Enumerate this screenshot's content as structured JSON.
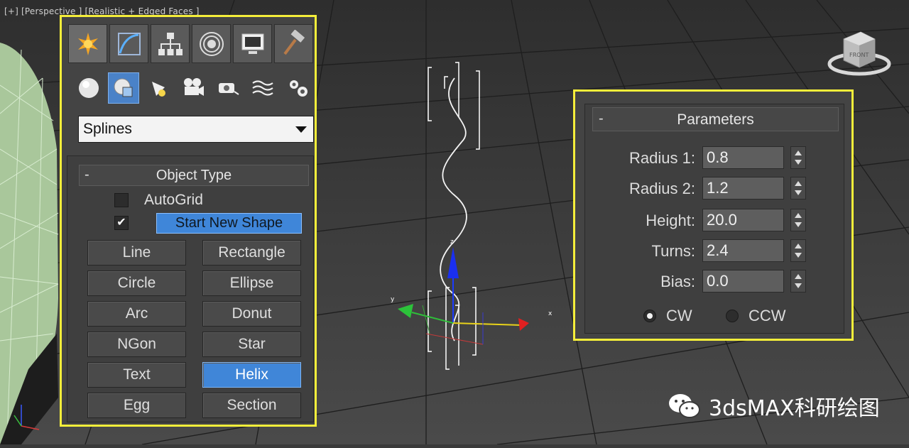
{
  "viewport": {
    "label": "[+] [Perspective ] [Realistic + Edged Faces ]",
    "axis_x": "x",
    "axis_y": "y",
    "axis_z": "z",
    "viewcube_label": "FRONT"
  },
  "command_panel": {
    "tabs": [
      {
        "icon": "create-icon",
        "active": true
      },
      {
        "icon": "modify-icon",
        "active": false
      },
      {
        "icon": "hierarchy-icon",
        "active": false
      },
      {
        "icon": "motion-icon",
        "active": false
      },
      {
        "icon": "display-icon",
        "active": false
      },
      {
        "icon": "utilities-icon",
        "active": false
      }
    ],
    "subtabs": [
      {
        "icon": "geometry-icon",
        "active": false
      },
      {
        "icon": "shapes-icon",
        "active": true
      },
      {
        "icon": "lights-icon",
        "active": false
      },
      {
        "icon": "cameras-icon",
        "active": false
      },
      {
        "icon": "helpers-icon",
        "active": false
      },
      {
        "icon": "spacewarps-icon",
        "active": false
      },
      {
        "icon": "systems-icon",
        "active": false
      }
    ],
    "category_dropdown": "Splines",
    "object_type": {
      "title": "Object Type",
      "collapse": "-",
      "autogrid_label": "AutoGrid",
      "autogrid_checked": false,
      "start_new_shape_checked": true,
      "start_new_shape_label": "Start New Shape",
      "buttons": [
        "Line",
        "Rectangle",
        "Circle",
        "Ellipse",
        "Arc",
        "Donut",
        "NGon",
        "Star",
        "Text",
        "Helix",
        "Egg",
        "Section"
      ],
      "active_button": "Helix"
    }
  },
  "parameters": {
    "title": "Parameters",
    "collapse": "-",
    "radius1_label": "Radius 1:",
    "radius1_value": "0.8",
    "radius2_label": "Radius 2:",
    "radius2_value": "1.2",
    "height_label": "Height:",
    "height_value": "20.0",
    "turns_label": "Turns:",
    "turns_value": "2.4",
    "bias_label": "Bias:",
    "bias_value": "0.0",
    "cw_label": "CW",
    "ccw_label": "CCW",
    "direction": "CW"
  },
  "watermark": {
    "text": "3dsMAX科研绘图",
    "icon": "wechat-icon"
  },
  "colors": {
    "highlight_border": "#f5ee3a",
    "active_blue": "#4086d8",
    "viewport_bg": "#3a3a3a"
  }
}
